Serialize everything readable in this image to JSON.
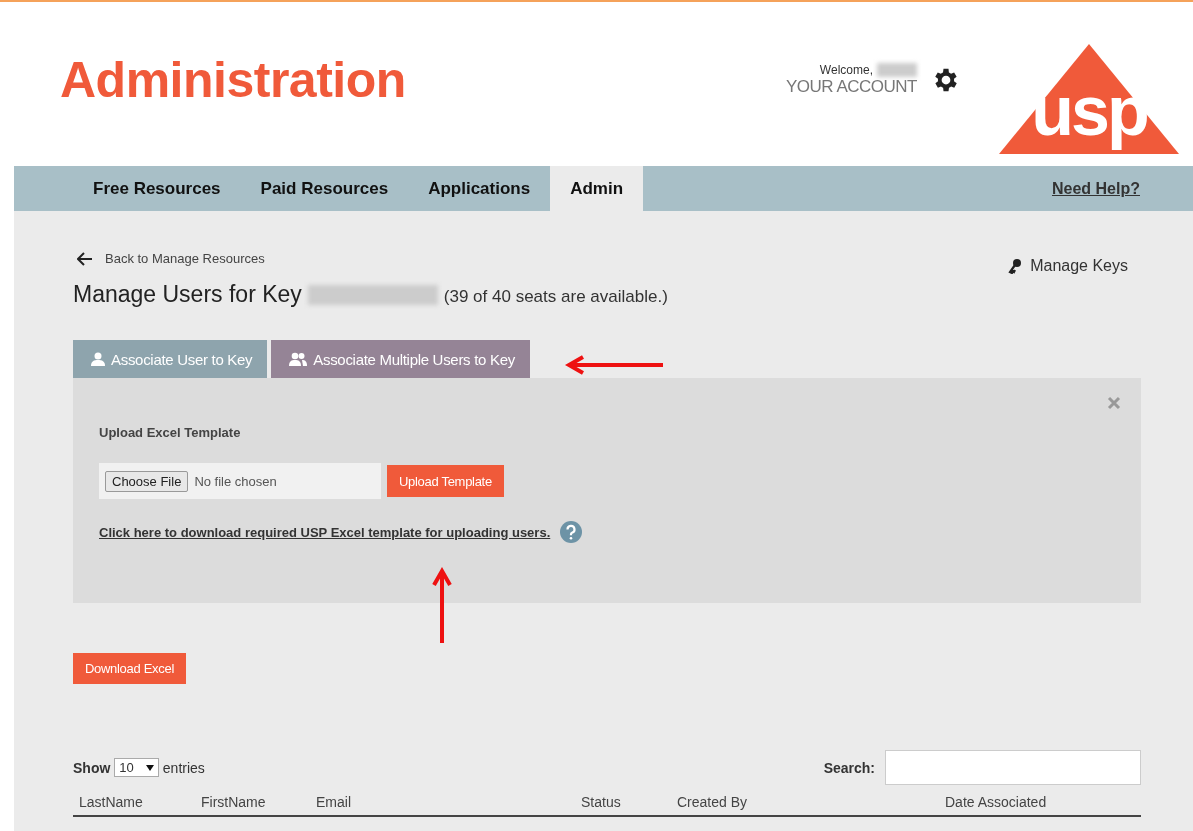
{
  "header": {
    "title": "Administration",
    "welcome": "Welcome,",
    "account": "YOUR ACCOUNT",
    "logo_text": "usp"
  },
  "nav": {
    "items": [
      {
        "label": "Free Resources",
        "selected": false
      },
      {
        "label": "Paid Resources",
        "selected": false
      },
      {
        "label": "Applications",
        "selected": false
      },
      {
        "label": "Admin",
        "selected": true
      }
    ],
    "help": "Need Help?"
  },
  "back_link": "Back to Manage Resources",
  "manage_keys": "Manage Keys",
  "heading": "Manage Users for Key",
  "seats": "(39 of 40 seats are available.)",
  "tabs": [
    {
      "label": "Associate User to Key",
      "selected": false,
      "kind": "single"
    },
    {
      "label": "Associate Multiple Users to Key",
      "selected": true,
      "kind": "multiple"
    }
  ],
  "upload": {
    "label": "Upload Excel Template",
    "choose": "Choose File",
    "no_file": "No file chosen",
    "button": "Upload Template",
    "link": "Click here to download required USP Excel template for uploading users."
  },
  "download_button": "Download Excel",
  "table": {
    "show": "Show",
    "page_size": "10",
    "entries": "entries",
    "search_label": "Search:",
    "columns": [
      "LastName",
      "FirstName",
      "Email",
      "Status",
      "Created By",
      "Date Associated"
    ]
  }
}
